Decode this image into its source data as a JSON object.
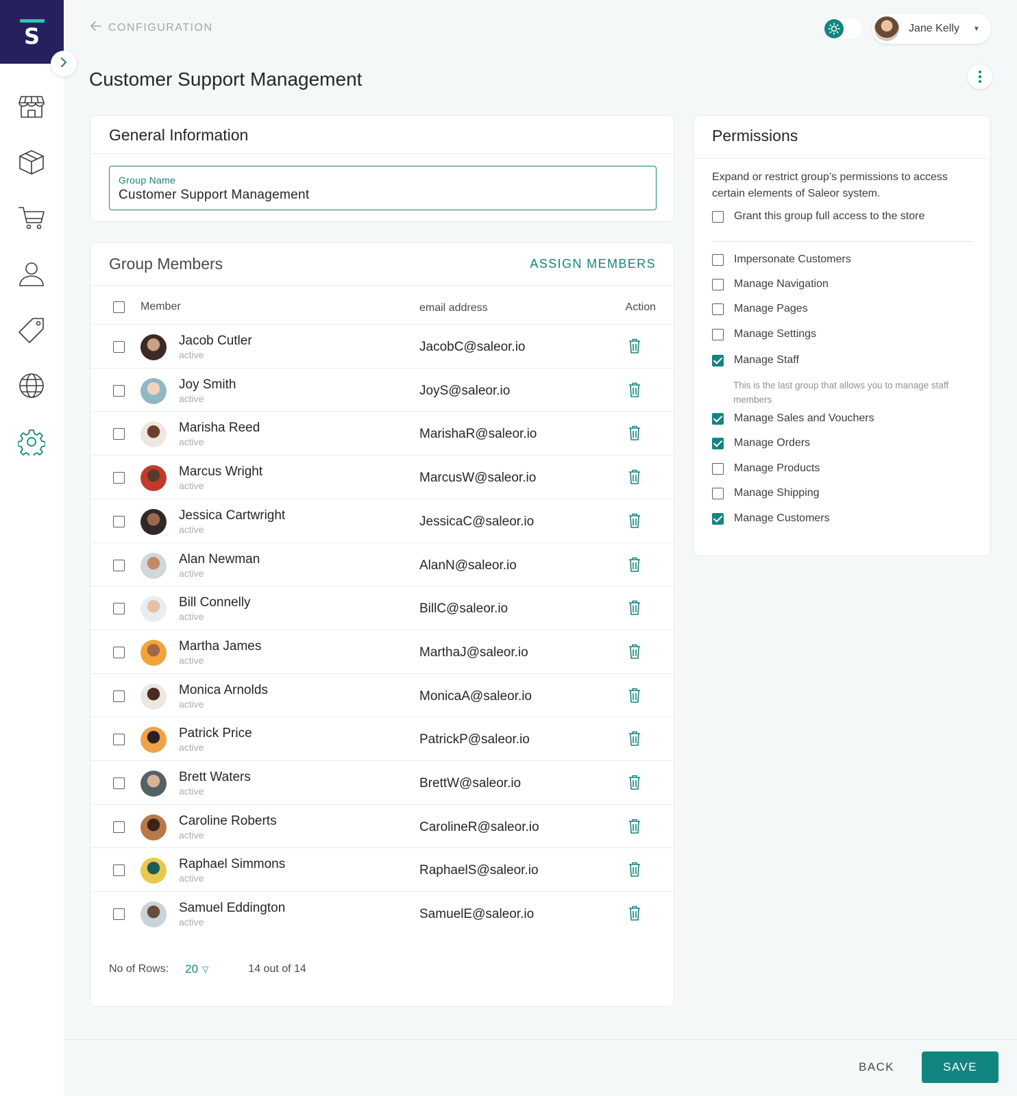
{
  "app": {
    "logo_letter": "S"
  },
  "nav": {
    "back_label": "CONFIGURATION",
    "icons": [
      "store-icon",
      "product-box-icon",
      "cart-icon",
      "user-icon",
      "tag-icon",
      "globe-icon",
      "settings-gear-icon"
    ]
  },
  "user": {
    "name": "Jane Kelly"
  },
  "page": {
    "title": "Customer Support Management"
  },
  "general": {
    "title": "General Information",
    "field_label": "Group Name",
    "field_value": "Customer Support Management"
  },
  "members": {
    "title": "Group Members",
    "assign_label": "ASSIGN MEMBERS",
    "columns": {
      "member": "Member",
      "email": "email address",
      "action": "Action"
    },
    "rows": [
      {
        "name": "Jacob Cutler",
        "status": "active",
        "email": "JacobC@saleor.io"
      },
      {
        "name": "Joy Smith",
        "status": "active",
        "email": "JoyS@saleor.io"
      },
      {
        "name": "Marisha Reed",
        "status": "active",
        "email": "MarishaR@saleor.io"
      },
      {
        "name": "Marcus Wright",
        "status": "active",
        "email": "MarcusW@saleor.io"
      },
      {
        "name": "Jessica Cartwright",
        "status": "active",
        "email": "JessicaC@saleor.io"
      },
      {
        "name": "Alan Newman",
        "status": "active",
        "email": "AlanN@saleor.io"
      },
      {
        "name": "Bill Connelly",
        "status": "active",
        "email": "BillC@saleor.io"
      },
      {
        "name": "Martha James",
        "status": "active",
        "email": "MarthaJ@saleor.io"
      },
      {
        "name": "Monica Arnolds",
        "status": "active",
        "email": "MonicaA@saleor.io"
      },
      {
        "name": "Patrick Price",
        "status": "active",
        "email": "PatrickP@saleor.io"
      },
      {
        "name": "Brett Waters",
        "status": "active",
        "email": "BrettW@saleor.io"
      },
      {
        "name": "Caroline Roberts",
        "status": "active",
        "email": "CarolineR@saleor.io"
      },
      {
        "name": "Raphael Simmons",
        "status": "active",
        "email": "RaphaelS@saleor.io"
      },
      {
        "name": "Samuel Eddington",
        "status": "active",
        "email": "SamuelE@saleor.io"
      }
    ],
    "rows_label": "No of Rows:",
    "rows_value": "20",
    "count_label": "14 out of 14"
  },
  "permissions": {
    "title": "Permissions",
    "description": "Expand or restrict group’s permissions to access certain elements of Saleor system.",
    "full_access": {
      "label": "Grant this group full access to the store",
      "checked": false
    },
    "items": [
      {
        "label": "Impersonate Customers",
        "checked": false
      },
      {
        "label": "Manage Navigation",
        "checked": false
      },
      {
        "label": "Manage Pages",
        "checked": false
      },
      {
        "label": "Manage Settings",
        "checked": false
      },
      {
        "label": "Manage Staff",
        "checked": true
      },
      {
        "label": "Manage Sales and Vouchers",
        "checked": true
      },
      {
        "label": "Manage Orders",
        "checked": true
      },
      {
        "label": "Manage Products",
        "checked": false
      },
      {
        "label": "Manage Shipping",
        "checked": false
      },
      {
        "label": "Manage Customers",
        "checked": true
      }
    ],
    "staff_note": "This is the last group that allows you to manage staff members"
  },
  "actions": {
    "back_label": "BACK",
    "save_label": "SAVE"
  },
  "colors": {
    "accent": "#138580",
    "sidebar_brand": "#26205f",
    "logo_bar": "#2ec4b6"
  }
}
